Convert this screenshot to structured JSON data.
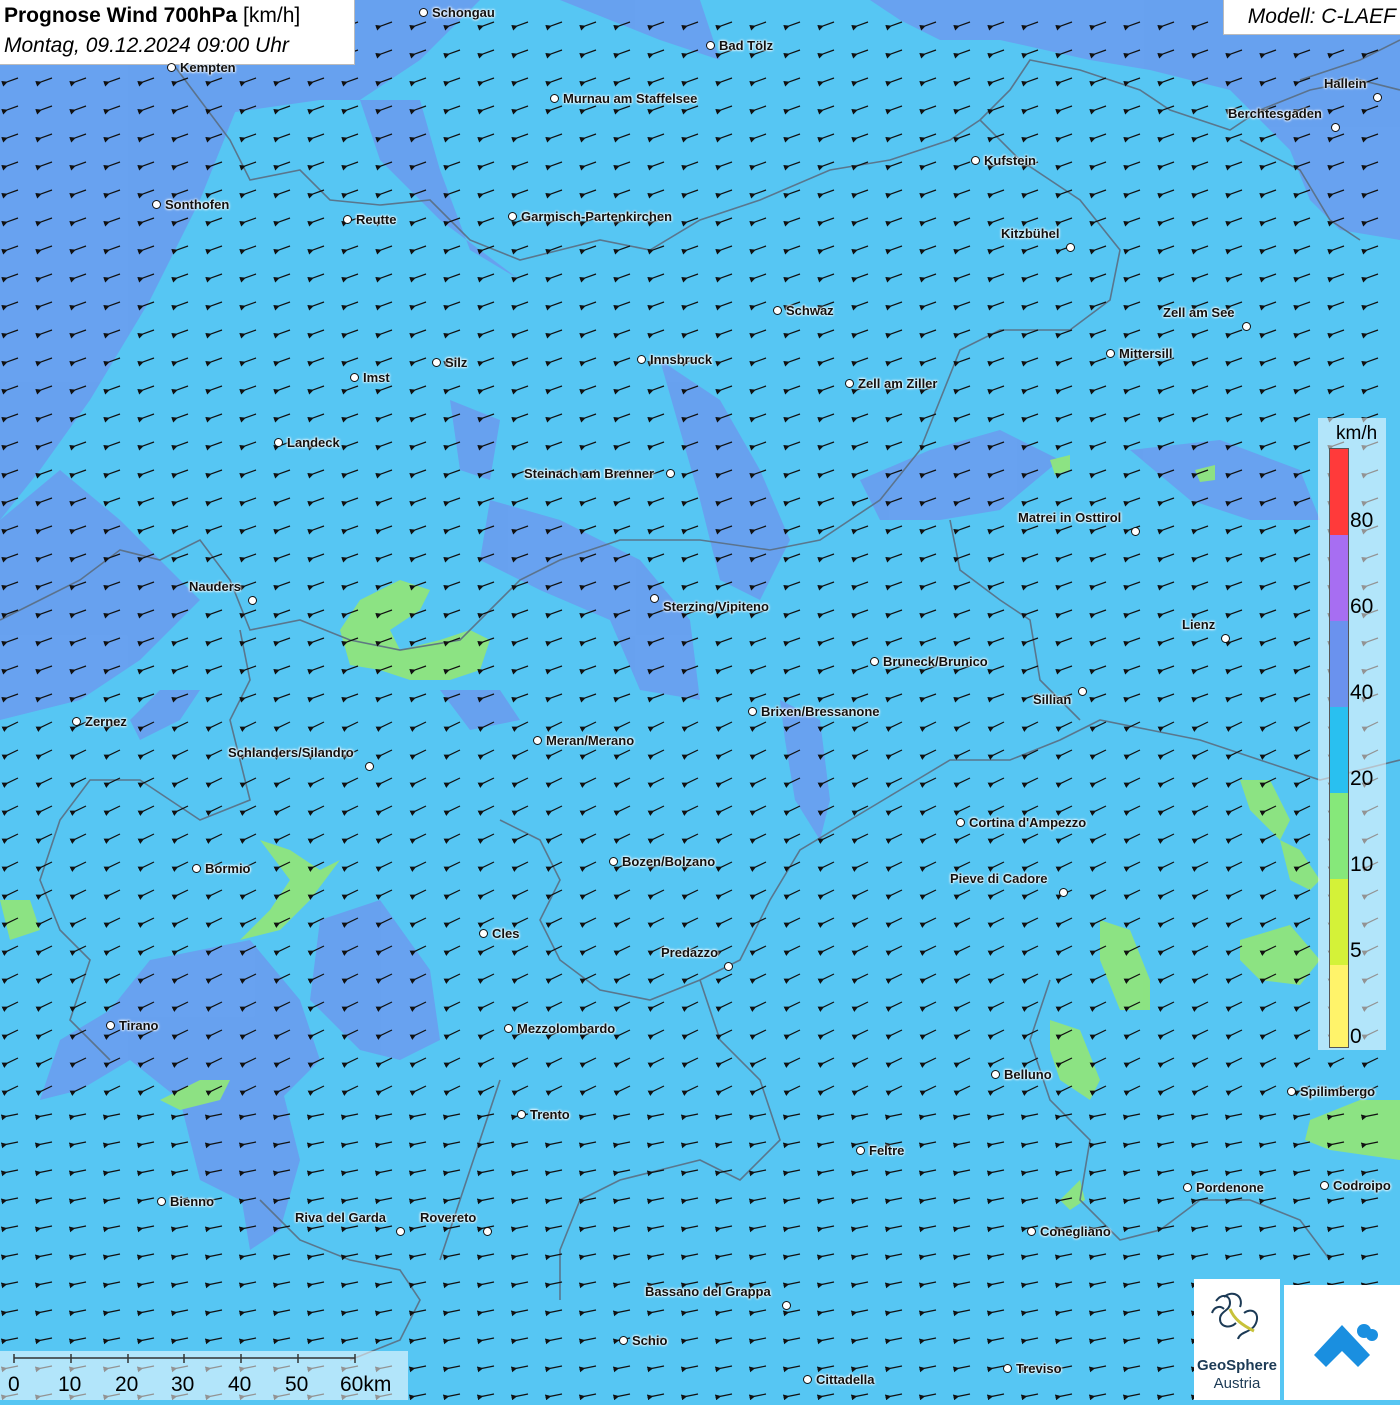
{
  "header": {
    "title": "Prognose Wind 700hPa",
    "title_unit": "[km/h]",
    "datetime": "Montag, 09.12.2024 09:00 Uhr"
  },
  "model": {
    "label": "Modell: C-LAEF"
  },
  "legend": {
    "unit": "km/h",
    "ticks": [
      "80",
      "60",
      "40",
      "20",
      "10",
      "5",
      "0"
    ],
    "colors": [
      "#ff3a3a",
      "#a76ef2",
      "#6a92ee",
      "#29c0f0",
      "#86e87a",
      "#d4f238",
      "#fff36a"
    ]
  },
  "scalebar": {
    "labels": [
      "0",
      "10",
      "20",
      "30",
      "40",
      "50",
      "60km"
    ]
  },
  "logos": {
    "geosphere_line1": "GeoSphere",
    "geosphere_line2": "Austria"
  },
  "wind": {
    "direction": "Wind aus Nordost",
    "dominant_band": "20 - 40 km/h"
  },
  "cities": [
    "Schongau",
    "Bad Tölz",
    "Kempten",
    "Murnau am Staffelsee",
    "Hallein",
    "Berchtesgaden",
    "Kufstein",
    "Sonthofen",
    "Reutte",
    "Garmisch-Partenkirchen",
    "Kitzbühel",
    "Schwaz",
    "Zell am See",
    "Mittersill",
    "Innsbruck",
    "Silz",
    "Imst",
    "Zell am Ziller",
    "Landeck",
    "Steinach am Brenner",
    "Matrei in Osttirol",
    "Nauders",
    "Sterzing/Vipiteno",
    "Lienz",
    "Bruneck/Brunico",
    "Sillian",
    "Zernez",
    "Brixen/Bressanone",
    "Meran/Merano",
    "Schlanders/Silandro",
    "Cortina d'Ampezzo",
    "Bozen/Bolzano",
    "Bormio",
    "Pieve di Cadore",
    "Cles",
    "Predazzo",
    "Tirano",
    "Mezzolombardo",
    "Belluno",
    "Spilimbergo",
    "Trento",
    "Feltre",
    "Pordenone",
    "Codroipo",
    "Bienno",
    "Riva del Garda",
    "Rovereto",
    "Conegliano",
    "Bassano del Grappa",
    "Schio",
    "Treviso",
    "Cittadella"
  ]
}
